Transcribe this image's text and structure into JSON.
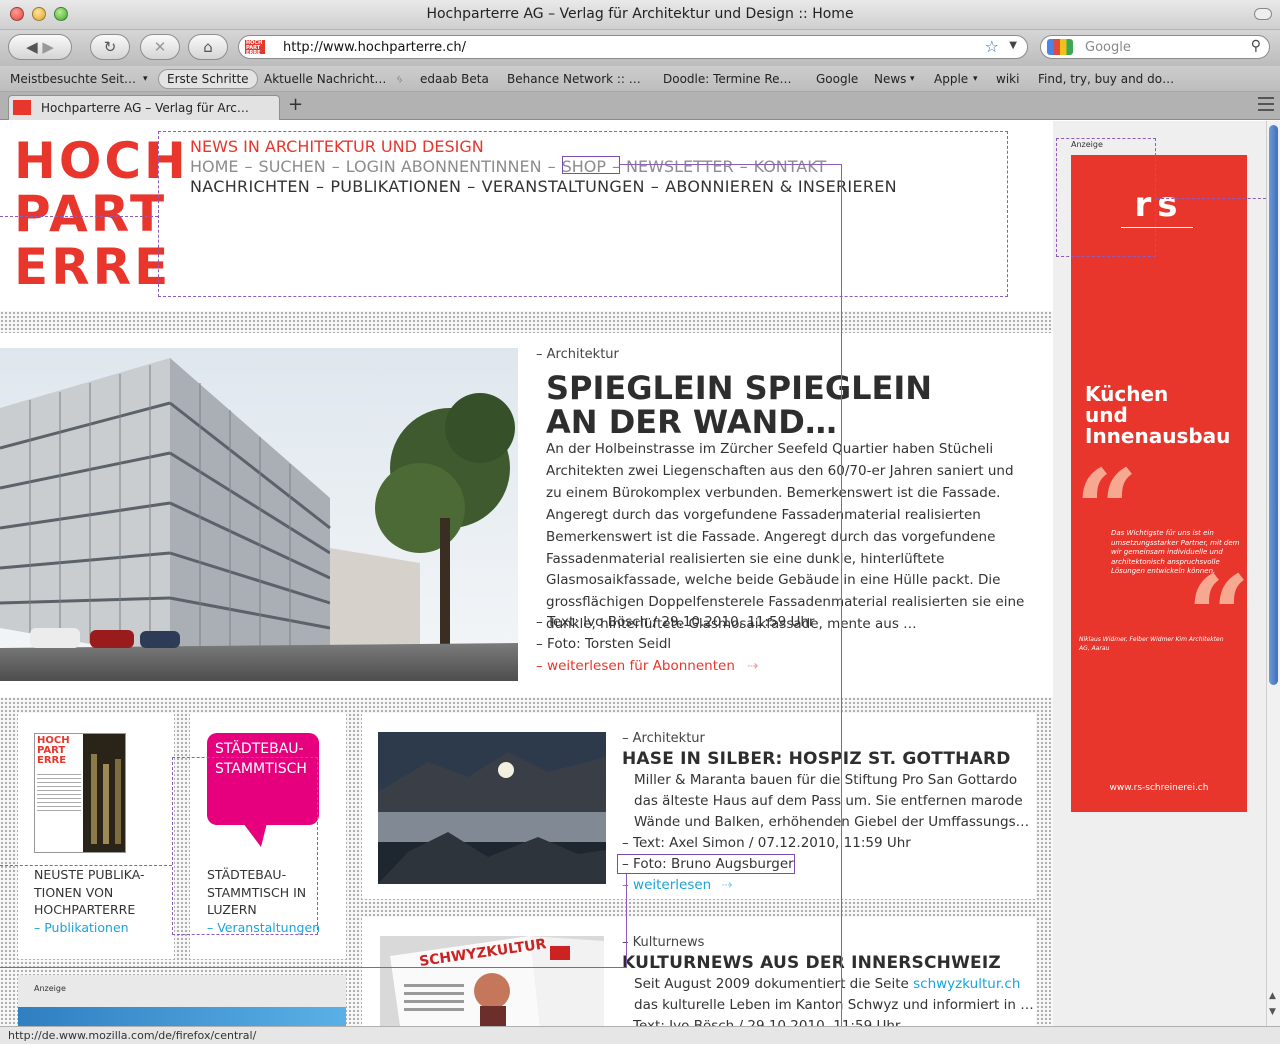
{
  "window": {
    "title": "Hochparterre AG – Verlag für Architektur und Design :: Home"
  },
  "navbar": {
    "url": "http://www.hochparterre.ch/",
    "search_placeholder": "Google"
  },
  "bookmarks": [
    "Meistbesuchte Seit…",
    "Erste Schritte",
    "Aktuelle Nachricht…",
    "edaab Beta",
    "Behance Network :: …",
    "Doodle: Termine Re…",
    "Google",
    "News",
    "Apple",
    "wiki",
    "Find, try, buy and do…"
  ],
  "tab": {
    "title": "Hochparterre AG – Verlag für Arc…",
    "new_tab": "+"
  },
  "status": {
    "url": "http://de.www.mozilla.com/de/firefox/central/"
  },
  "site": {
    "logo": [
      "HOCH",
      "PART",
      "ERRE"
    ],
    "tagline": "NEWS IN ARCHITEKTUR UND DESIGN",
    "nav_secondary": [
      "HOME",
      "SUCHEN",
      "LOGIN ABONNENTINNEN",
      "SHOP",
      "NEWSLETTER",
      "KONTAKT"
    ],
    "nav_primary": [
      "NACHRICHTEN",
      "PUBLIKATIONEN",
      "VERANSTALTUNGEN",
      "ABONNIEREN & INSERIEREN"
    ],
    "nav_separator": "–"
  },
  "hero": {
    "category": "– Architektur",
    "title_line1": "SPIEGLEIN SPIEGLEIN",
    "title_line2": "AN DER WAND…",
    "lead": "An der Holbeinstrasse im Zürcher Seefeld Quartier haben Stücheli Archi­tekten zwei Liegenschaften aus den 60/70-er Jahren saniert und zu einem Bürokomplex verbunden. Bemerkenswert ist die Fassade. Angeregt durch das vorgefundene Fassadenmaterial realisierten Bemerkenswert ist die Fassade. Angeregt durch das vorgefundene Fassadenmaterial realisierten sie eine dunkle, hinterlüftete Glasmosaikfassade, welche beide Gebäude in eine Hülle packt. Die grossflächigen Doppelfensterele Fassadenmaterial realisierten sie eine dunkle, hinterlüftete Glasmosaikfassade, mente aus …",
    "text_credit": "– Text: Ivo Bösch / 29.10.2010, 11:59 Uhr",
    "photo_credit": "– Foto: Torsten Seidl",
    "read_more": "– weiterlesen für Abonnenten",
    "arrow": "⇢"
  },
  "cards": [
    {
      "text": "NEUSTE PUBLIKA­TIONEN VON HOCHPARTERRE",
      "lines": [
        "NEUSTE PUBLIKA-",
        "TIONEN VON",
        "HOCHPARTERRE"
      ],
      "link": "– Publikationen"
    },
    {
      "bubble_lines": [
        "STÄDTEBAU-",
        "STAMMTISCH"
      ],
      "lines": [
        "STÄDTEBAU-",
        "STAMMTISCH IN",
        "LUZERN"
      ],
      "link": "– Veranstaltungen"
    }
  ],
  "articles": [
    {
      "category": "– Architektur",
      "title": "HASE IN SILBER: HOSPIZ ST. GOTTHARD",
      "lines": [
        "Miller & Maranta bauen für die Stiftung Pro San Gottardo",
        "das älteste Haus auf dem Pass um. Sie entfernen marode",
        "Wände und Balken, erhöhenden Giebel der Umffassungs…"
      ],
      "text_credit": "– Text: Axel Simon / 07.12.2010, 11:59 Uhr",
      "photo_credit": "– Foto: Bruno Augsburger",
      "read_more": "– weiterlesen"
    },
    {
      "category": "– Kulturnews",
      "title": "KULTURNEWS AUS DER INNERSCHWEIZ",
      "line1_prefix": "Seit August 2009 dokumentiert die Seite ",
      "line1_link": "schwyzkultur.ch",
      "line2": "das kulturelle Leben im Kanton Schwyz und informiert in …",
      "text_credit": "– Text: Ivo Bösch / 29.10.2010, 11:59 Uhr"
    }
  ],
  "ads": {
    "label": "Anzeige",
    "rs": {
      "logo": "rs",
      "headline": [
        "Küchen",
        "und",
        "Innenausbau"
      ],
      "quote": "Das Wichtigste für uns ist ein umsetzungsstarker Partner, mit dem wir gemein­sam individuelle und archi­tektonisch anspruchsvolle Lösungen entwickeln können.",
      "signature": "Niklaus Widmer, Felber Widmer Kim Architekten AG, Aarau",
      "url": "www.rs-schreinerei.ch"
    }
  },
  "colors": {
    "brand_red": "#e8362c",
    "link_blue": "#1aa4d8",
    "magenta": "#e6007e",
    "annotation": "#8c5bbb"
  }
}
